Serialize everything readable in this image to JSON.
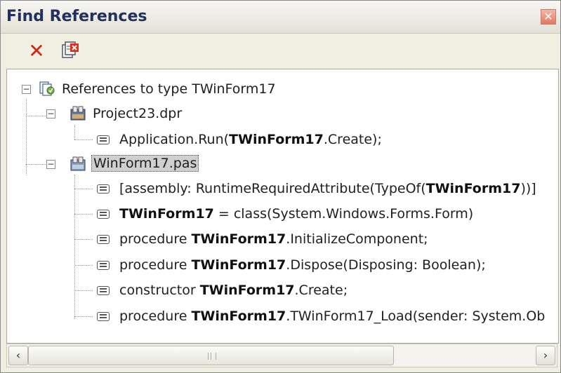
{
  "window": {
    "title": "Find References",
    "close_glyph": "✕"
  },
  "toolbar": {
    "clear_glyph": "✕",
    "clear_icon": "clear-all-icon",
    "remove_icon": "remove-reference-icon"
  },
  "tree": {
    "root": {
      "label": "References to type TWinForm17",
      "icon": "references-icon",
      "expander": "−"
    },
    "project": {
      "label": "Project23.dpr",
      "icon": "project-file-icon",
      "expander": "−",
      "items": [
        {
          "before": "Application.Run(",
          "bold": "TWinForm17",
          "after": ".Create);"
        }
      ]
    },
    "unit": {
      "label": "WinForm17.pas",
      "icon": "unit-file-icon",
      "expander": "−",
      "items": [
        {
          "before": "[assembly: RuntimeRequiredAttribute(TypeOf(",
          "bold": "TWinForm17",
          "after": "))]"
        },
        {
          "before": "",
          "bold": "TWinForm17",
          "after": " = class(System.Windows.Forms.Form)"
        },
        {
          "before": "procedure ",
          "bold": "TWinForm17",
          "after": ".InitializeComponent;"
        },
        {
          "before": "procedure ",
          "bold": "TWinForm17",
          "after": ".Dispose(Disposing: Boolean);"
        },
        {
          "before": "constructor ",
          "bold": "TWinForm17",
          "after": ".Create;"
        },
        {
          "before": "procedure ",
          "bold": "TWinForm17",
          "after": ".TWinForm17_Load(sender: System.Ob"
        }
      ]
    }
  },
  "scrollbar": {
    "left_glyph": "‹",
    "right_glyph": "›",
    "thumb_fraction": 0.72
  }
}
